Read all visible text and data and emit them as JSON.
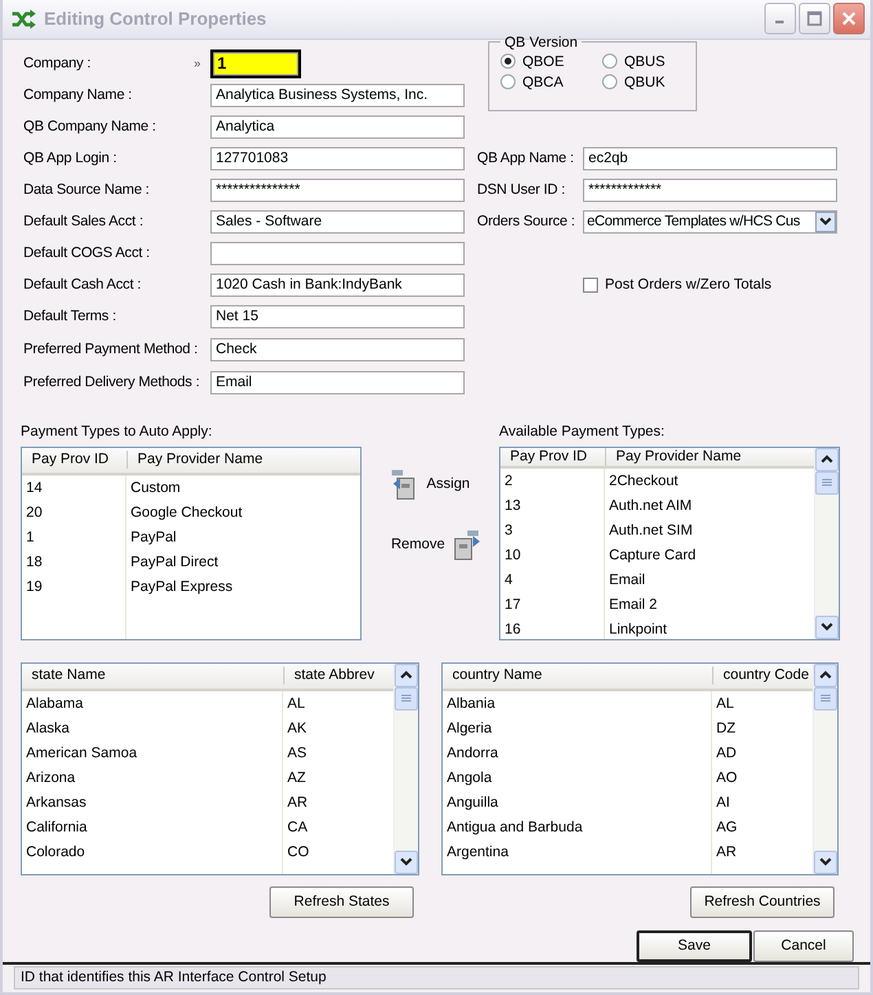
{
  "window": {
    "title": "Editing Control Properties"
  },
  "fields_left": [
    {
      "label": "Company :",
      "value": "1",
      "kind": "key",
      "marker": "»"
    },
    {
      "label": "Company Name :",
      "value": "Analytica Business Systems, Inc.",
      "kind": "text"
    },
    {
      "label": "QB Company Name :",
      "value": "Analytica",
      "kind": "text"
    },
    {
      "label": "QB App Login :",
      "value": "127701083",
      "kind": "text"
    },
    {
      "label": "Data Source Name :",
      "value": "***************",
      "kind": "text"
    },
    {
      "label": "Default Sales Acct :",
      "value": "Sales - Software",
      "kind": "text"
    },
    {
      "label": "Default COGS Acct :",
      "kind": "text"
    },
    {
      "label": "Default Cash Acct :",
      "value": "1020 Cash in Bank:IndyBank",
      "kind": "text"
    },
    {
      "label": "Default Terms :",
      "value": "Net 15",
      "kind": "text"
    },
    {
      "label": "Preferred Payment Method :",
      "value": "Check",
      "kind": "text"
    },
    {
      "label": "Preferred Delivery Methods :",
      "value": "Email",
      "kind": "text"
    }
  ],
  "qb_version": {
    "title": "QB Version",
    "options": [
      {
        "label": "QBOE",
        "selected": true
      },
      {
        "label": "QBUS",
        "selected": false
      },
      {
        "label": "QBCA",
        "selected": false
      },
      {
        "label": "QBUK",
        "selected": false
      }
    ]
  },
  "fields_right": [
    {
      "label": "QB App Name :",
      "value": "ec2qb",
      "kind": "text"
    },
    {
      "label": "DSN User ID :",
      "value": "*************",
      "kind": "text"
    },
    {
      "label": "Orders Source :",
      "value": "eCommerce Templates w/HCS Cus",
      "kind": "dropdown"
    }
  ],
  "post_orders_zero": {
    "label": "Post Orders w/Zero Totals",
    "checked": false
  },
  "payment_auto": {
    "title": "Payment Types to Auto Apply:",
    "columns": [
      "Pay Prov ID",
      "Pay Provider Name"
    ],
    "rows": [
      [
        "14",
        "Custom"
      ],
      [
        "20",
        "Google Checkout"
      ],
      [
        "1",
        "PayPal"
      ],
      [
        "18",
        "PayPal Direct"
      ],
      [
        "19",
        "PayPal Express"
      ]
    ]
  },
  "assign_button": {
    "label": "Assign"
  },
  "remove_button": {
    "label": "Remove"
  },
  "payment_available": {
    "title": "Available Payment Types:",
    "columns": [
      "Pay Prov ID",
      "Pay Provider Name"
    ],
    "rows": [
      [
        "2",
        "2Checkout"
      ],
      [
        "13",
        "Auth.net AIM"
      ],
      [
        "3",
        "Auth.net SIM"
      ],
      [
        "10",
        "Capture Card"
      ],
      [
        "4",
        "Email"
      ],
      [
        "17",
        "Email 2"
      ],
      [
        "16",
        "Linkpoint"
      ]
    ]
  },
  "states": {
    "columns": [
      "state Name",
      "state Abbrev"
    ],
    "rows": [
      [
        "Alabama",
        "AL"
      ],
      [
        "Alaska",
        "AK"
      ],
      [
        "American Samoa",
        "AS"
      ],
      [
        "Arizona",
        "AZ"
      ],
      [
        "Arkansas",
        "AR"
      ],
      [
        "California",
        "CA"
      ],
      [
        "Colorado",
        "CO"
      ]
    ]
  },
  "countries": {
    "columns": [
      "country Name",
      "country Code"
    ],
    "rows": [
      [
        "Albania",
        "AL"
      ],
      [
        "Algeria",
        "DZ"
      ],
      [
        "Andorra",
        "AD"
      ],
      [
        "Angola",
        "AO"
      ],
      [
        "Anguilla",
        "AI"
      ],
      [
        "Antigua and Barbuda",
        "AG"
      ],
      [
        "Argentina",
        "AR"
      ]
    ]
  },
  "refresh_states": {
    "label": "Refresh States"
  },
  "refresh_countries": {
    "label": "Refresh Countries"
  },
  "save_button": {
    "label": "Save"
  },
  "cancel_button": {
    "label": "Cancel"
  },
  "status_bar": "ID that identifies this AR Interface Control Setup"
}
